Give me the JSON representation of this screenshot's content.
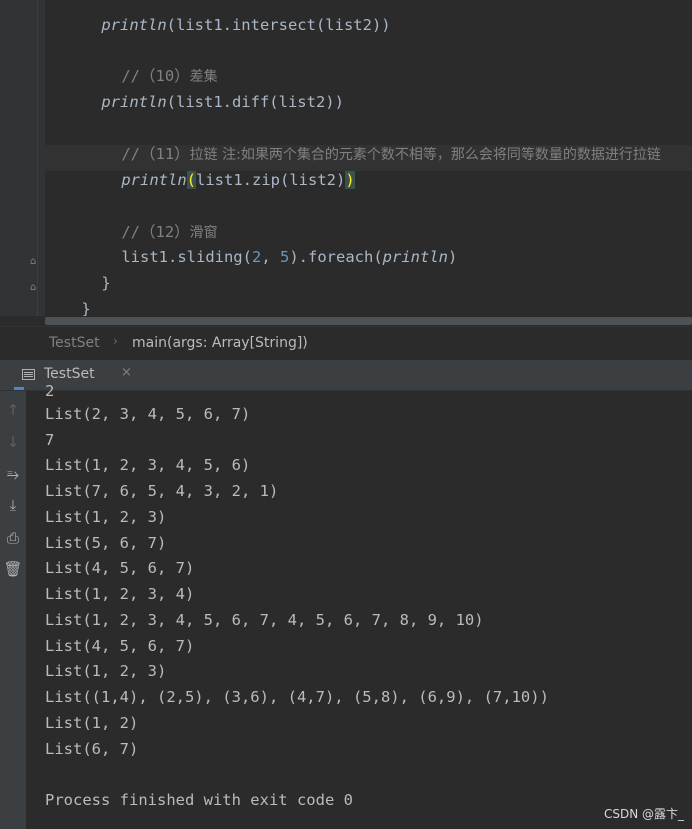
{
  "editor": {
    "line_intersect": {
      "fn": "println",
      "rest": "(list1.intersect(list2))"
    },
    "comment_diff": {
      "prefix": "//（10）",
      "text": "差集"
    },
    "line_diff": {
      "fn": "println",
      "rest": "(list1.diff(list2))"
    },
    "comment_zip": {
      "prefix": "//（11）",
      "text": "拉链 注:如果两个集合的元素个数不相等，那么会将同等数量的数据进行拉链"
    },
    "line_zip": {
      "fn": "println",
      "open": "(",
      "mid": "list1.zip(list2)",
      "close": ")"
    },
    "comment_sliding": {
      "prefix": "//（12）",
      "text": "滑窗"
    },
    "line_sliding": {
      "pre": "list1.sliding(",
      "n1": "2",
      "sep": ", ",
      "n2": "5",
      "post": ").foreach(",
      "fn": "println",
      "end": ")"
    },
    "inner_close": "}",
    "outer_close": "}"
  },
  "breadcrumb": {
    "object": "TestSet",
    "separator": "›",
    "method": "main(args: Array[String])"
  },
  "run_tab": {
    "label": "TestSet",
    "close": "×"
  },
  "tools": [
    {
      "icon": "arrow-up-icon",
      "glyph": "↑"
    },
    {
      "icon": "arrow-down-icon",
      "glyph": "↓"
    },
    {
      "icon": "soft-wrap-icon",
      "glyph": "⥱"
    },
    {
      "icon": "scroll-to-end-icon",
      "glyph": "⤓"
    },
    {
      "icon": "print-icon",
      "glyph": "⎙"
    },
    {
      "icon": "trash-icon",
      "glyph": "🗑"
    }
  ],
  "console": {
    "cut_line": "2",
    "lines": [
      "List(2, 3, 4, 5, 6, 7)",
      "7",
      "List(1, 2, 3, 4, 5, 6)",
      "List(7, 6, 5, 4, 3, 2, 1)",
      "List(1, 2, 3)",
      "List(5, 6, 7)",
      "List(4, 5, 6, 7)",
      "List(1, 2, 3, 4)",
      "List(1, 2, 3, 4, 5, 6, 7, 4, 5, 6, 7, 8, 9, 10)",
      "List(4, 5, 6, 7)",
      "List(1, 2, 3)",
      "List((1,4), (2,5), (3,6), (4,7), (5,8), (6,9), (7,10))",
      "List(1, 2)",
      "List(6, 7)",
      "",
      "Process finished with exit code 0"
    ]
  },
  "watermark": "CSDN @露卞_"
}
